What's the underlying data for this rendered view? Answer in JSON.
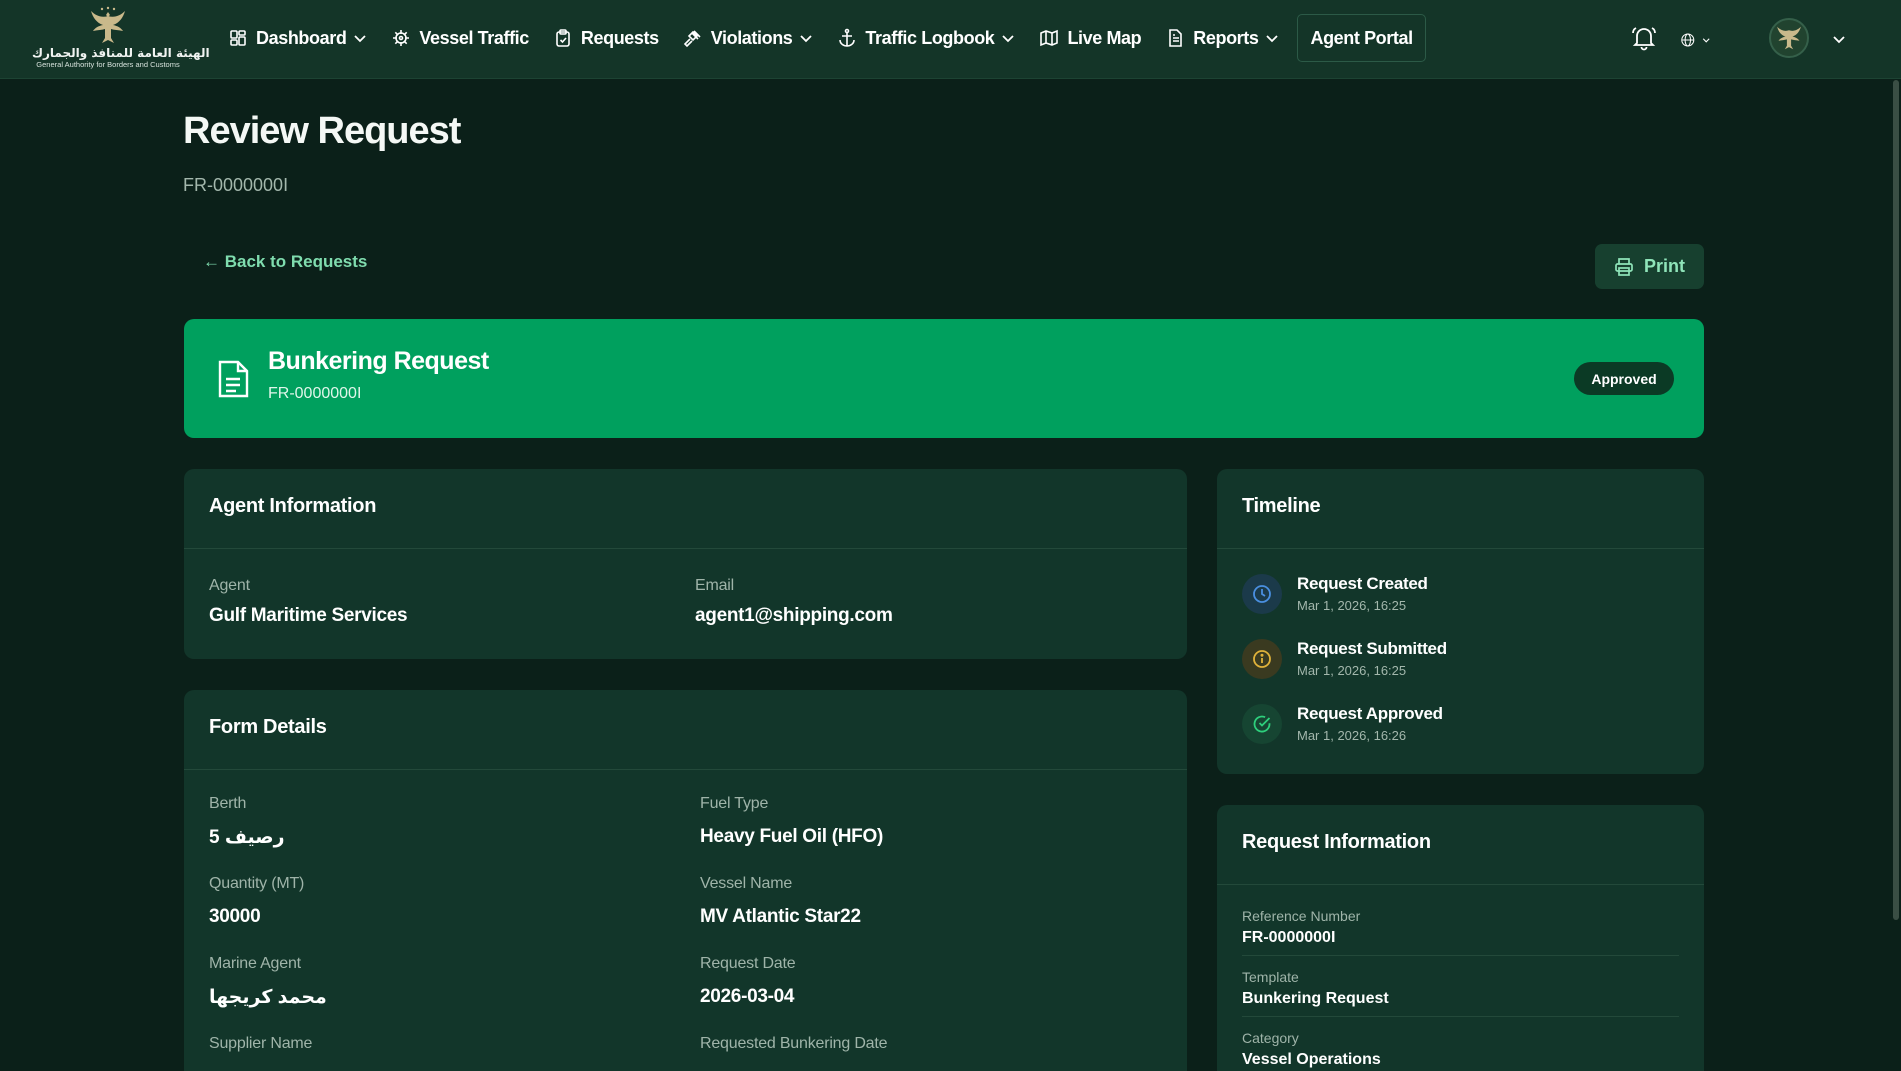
{
  "logo": {
    "arabic": "الهيئة العامة للمنافذ والجمارك",
    "english": "General Authority for Borders and Customs"
  },
  "nav": {
    "items": [
      {
        "label": "Dashboard",
        "icon": "dashboard-icon",
        "dropdown": true
      },
      {
        "label": "Vessel Traffic",
        "icon": "helm-icon",
        "dropdown": false
      },
      {
        "label": "Requests",
        "icon": "clipboard-icon",
        "dropdown": false
      },
      {
        "label": "Violations",
        "icon": "gavel-icon",
        "dropdown": true
      },
      {
        "label": "Traffic Logbook",
        "icon": "anchor-icon",
        "dropdown": true
      },
      {
        "label": "Live Map",
        "icon": "map-icon",
        "dropdown": false
      },
      {
        "label": "Reports",
        "icon": "report-icon",
        "dropdown": true
      },
      {
        "label": "Agent Portal",
        "icon": "",
        "dropdown": false
      }
    ]
  },
  "header": {
    "title": "Review Request",
    "subtitle": "FR-0000000I",
    "back_label": "← Back to Requests",
    "print_label": "Print"
  },
  "banner": {
    "title": "Bunkering Request",
    "reference": "FR-0000000I",
    "status": "Approved",
    "color": "#00a05e"
  },
  "agent_info": {
    "heading": "Agent Information",
    "agent_label": "Agent",
    "agent_value": "Gulf Maritime Services",
    "email_label": "Email",
    "email_value": "agent1@shipping.com"
  },
  "form_details": {
    "heading": "Form Details",
    "fields": [
      {
        "label": "Berth",
        "value": "رصيف 5"
      },
      {
        "label": "Fuel Type",
        "value": "Heavy Fuel Oil (HFO)"
      },
      {
        "label": "Quantity (MT)",
        "value": "30000"
      },
      {
        "label": "Vessel Name",
        "value": "MV Atlantic Star22"
      },
      {
        "label": "Marine Agent",
        "value": "محمد كريجها"
      },
      {
        "label": "Request Date",
        "value": "2026-03-04"
      },
      {
        "label": "Supplier Name",
        "value": ""
      },
      {
        "label": "Requested Bunkering Date",
        "value": ""
      }
    ]
  },
  "timeline": {
    "heading": "Timeline",
    "items": [
      {
        "title": "Request Created",
        "time": "Mar 1, 2026, 16:25",
        "icon": "clock-icon",
        "color": "#4a8fe0"
      },
      {
        "title": "Request Submitted",
        "time": "Mar 1, 2026, 16:25",
        "icon": "info-icon",
        "color": "#e0b23a"
      },
      {
        "title": "Request Approved",
        "time": "Mar 1, 2026, 16:26",
        "icon": "check-circle-icon",
        "color": "#2ecf7c"
      }
    ]
  },
  "request_info": {
    "heading": "Request Information",
    "rows": [
      {
        "label": "Reference Number",
        "value": "FR-0000000I"
      },
      {
        "label": "Template",
        "value": "Bunkering Request"
      },
      {
        "label": "Category",
        "value": "Vessel Operations"
      }
    ]
  }
}
